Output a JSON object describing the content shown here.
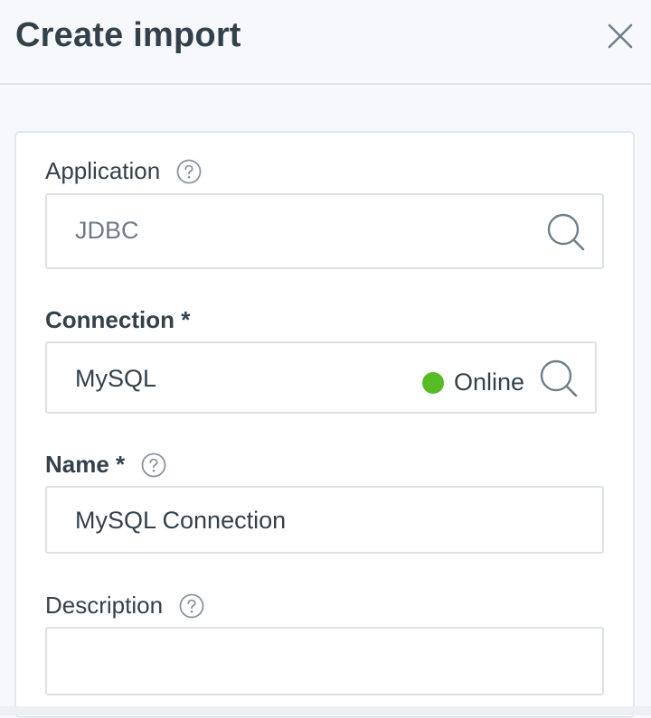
{
  "header": {
    "title": "Create import"
  },
  "form": {
    "application": {
      "label": "Application",
      "value": "JDBC"
    },
    "connection": {
      "label": "Connection *",
      "value": "MySQL",
      "status": "Online",
      "status_color": "#56bc25"
    },
    "name": {
      "label": "Name *",
      "value": "MySQL Connection"
    },
    "description": {
      "label": "Description",
      "value": ""
    }
  },
  "colors": {
    "text": "#33414b",
    "muted_text": "#6c7c88",
    "border": "#dbe2e8",
    "icon": "#6e7e8a",
    "background": "#f6f8fc"
  }
}
